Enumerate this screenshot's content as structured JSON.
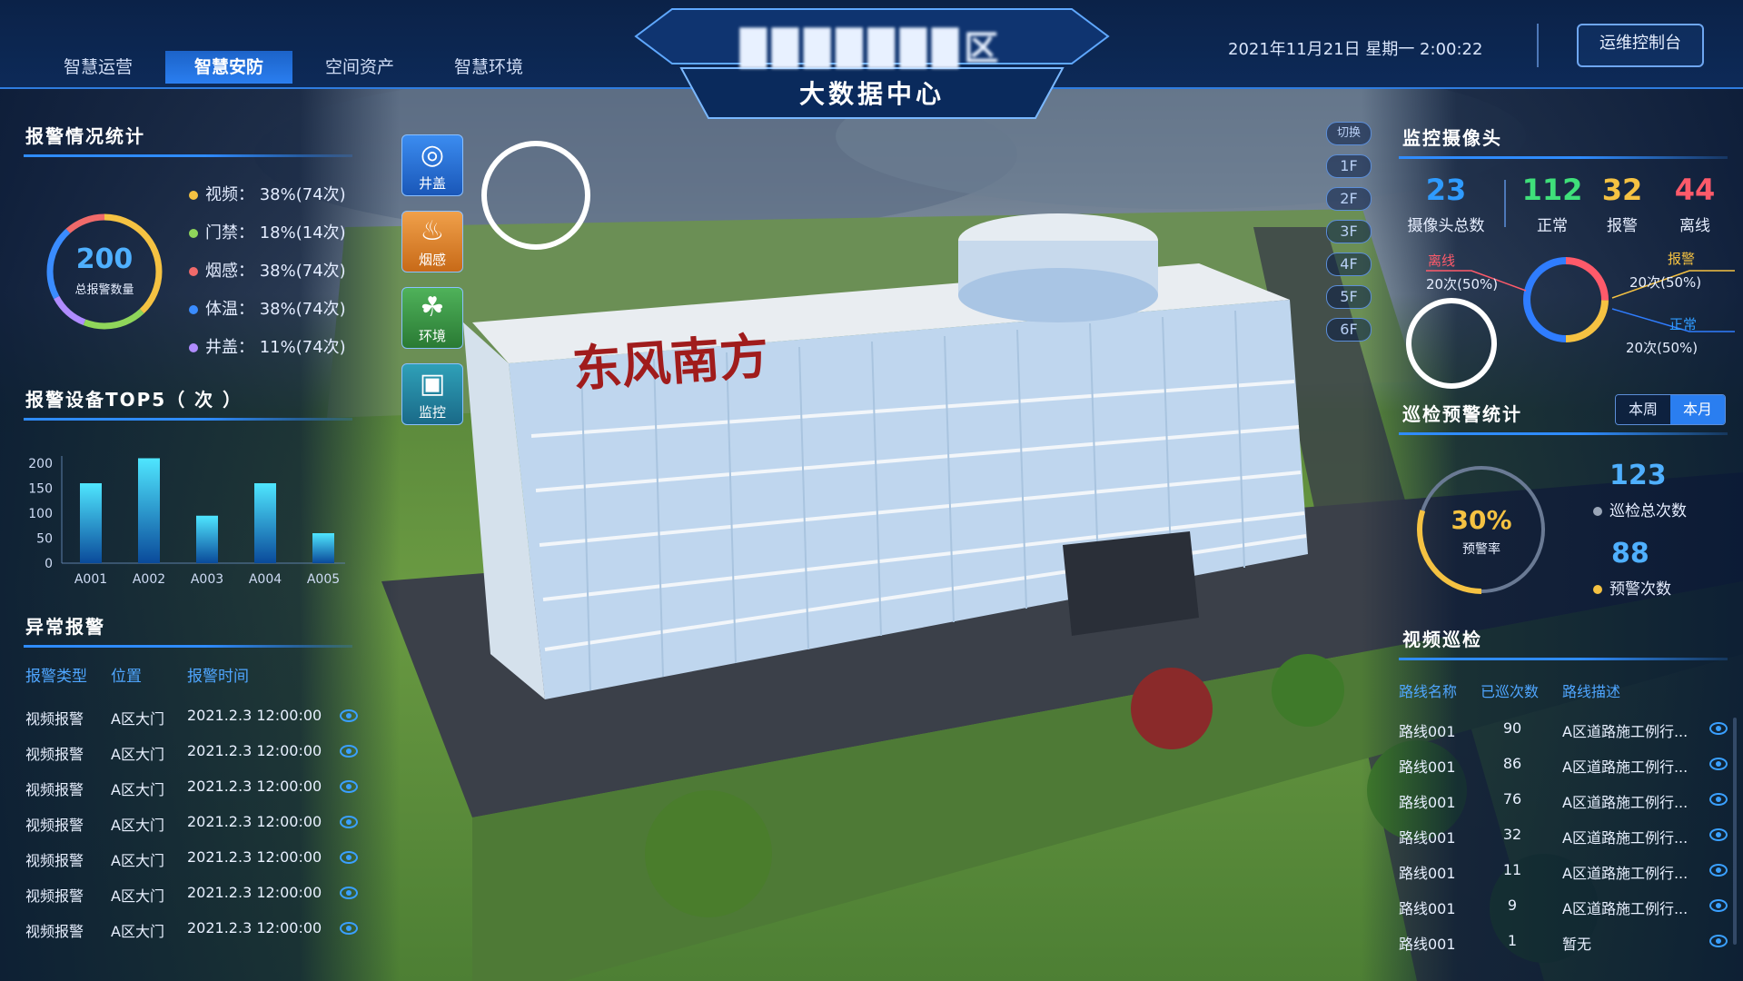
{
  "header": {
    "title": "███████区",
    "subtitle": "大数据中心",
    "datetime": "2021年11月21日  星期一  2:00:22",
    "ops_button": "运维控制台",
    "tabs": [
      {
        "label": "智慧运营",
        "active": false
      },
      {
        "label": "智慧安防",
        "active": true
      },
      {
        "label": "空间资产",
        "active": false
      },
      {
        "label": "智慧环境",
        "active": false
      }
    ]
  },
  "alarm_stats": {
    "title": "报警情况统计",
    "total": "200",
    "total_label": "总报警数量",
    "items": [
      {
        "label": "视频： 38%(74次)",
        "color": "#f5c242"
      },
      {
        "label": "门禁： 18%(14次)",
        "color": "#8fd65a"
      },
      {
        "label": "烟感： 38%(74次)",
        "color": "#f06a6a"
      },
      {
        "label": "体温： 38%(74次)",
        "color": "#3a8cff"
      },
      {
        "label": "井盖： 11%(74次)",
        "color": "#b08cff"
      }
    ]
  },
  "top5": {
    "title": "报警设备TOP5（ 次 ）"
  },
  "chart_data": {
    "type": "bar",
    "categories": [
      "A001",
      "A002",
      "A003",
      "A004",
      "A005"
    ],
    "values": [
      160,
      210,
      95,
      160,
      60
    ],
    "yticks": [
      "200",
      "150",
      "100",
      "50",
      "0"
    ],
    "ylim": [
      0,
      200
    ],
    "title": "报警设备TOP5（ 次 ）",
    "xlabel": "",
    "ylabel": ""
  },
  "abnormal": {
    "title": "异常报警",
    "headers": [
      "报警类型",
      "位置",
      "报警时间"
    ],
    "rows": [
      [
        "视频报警",
        "A区大门",
        "2021.2.3 12:00:00"
      ],
      [
        "视频报警",
        "A区大门",
        "2021.2.3 12:00:00"
      ],
      [
        "视频报警",
        "A区大门",
        "2021.2.3 12:00:00"
      ],
      [
        "视频报警",
        "A区大门",
        "2021.2.3 12:00:00"
      ],
      [
        "视频报警",
        "A区大门",
        "2021.2.3 12:00:00"
      ],
      [
        "视频报警",
        "A区大门",
        "2021.2.3 12:00:00"
      ],
      [
        "视频报警",
        "A区大门",
        "2021.2.3 12:00:00"
      ]
    ]
  },
  "side_buttons": [
    {
      "label": "井盖",
      "icon": "manhole-icon"
    },
    {
      "label": "烟感",
      "icon": "smoke-icon"
    },
    {
      "label": "环境",
      "icon": "leaf-icon"
    },
    {
      "label": "监控",
      "icon": "camera-icon"
    }
  ],
  "floors": {
    "switch": "切换",
    "items": [
      "1F",
      "2F",
      "3F",
      "4F",
      "5F",
      "6F"
    ]
  },
  "building_label": "东风南方",
  "cameras": {
    "title": "监控摄像头",
    "stats": [
      {
        "value": "23",
        "label": "摄像头总数",
        "color": "#2f9bff"
      },
      {
        "value": "112",
        "label": "正常",
        "color": "#3fe07a"
      },
      {
        "value": "32",
        "label": "报警",
        "color": "#f5c242"
      },
      {
        "value": "44",
        "label": "离线",
        "color": "#ff5a6a"
      }
    ],
    "offline_label": "离线",
    "offline_value": "20次(50%)",
    "alarm_label": "报警",
    "alarm_value": "20次(50%)",
    "normal_label": "正常",
    "normal_value": "20次(50%)"
  },
  "patrol_warning": {
    "title": "巡检预警统计",
    "week": "本周",
    "month": "本月",
    "rate": "30%",
    "rate_label": "预警率",
    "total": "123",
    "total_label": "巡检总次数",
    "warn": "88",
    "warn_label": "预警次数"
  },
  "video_patrol": {
    "title": "视频巡检",
    "headers": [
      "路线名称",
      "已巡次数",
      "路线描述"
    ],
    "rows": [
      [
        "路线001",
        "90",
        "A区道路施工例行..."
      ],
      [
        "路线001",
        "86",
        "A区道路施工例行..."
      ],
      [
        "路线001",
        "76",
        "A区道路施工例行..."
      ],
      [
        "路线001",
        "32",
        "A区道路施工例行..."
      ],
      [
        "路线001",
        "11",
        "A区道路施工例行..."
      ],
      [
        "路线001",
        "9",
        "A区道路施工例行..."
      ],
      [
        "路线001",
        "1",
        "暂无"
      ]
    ]
  }
}
